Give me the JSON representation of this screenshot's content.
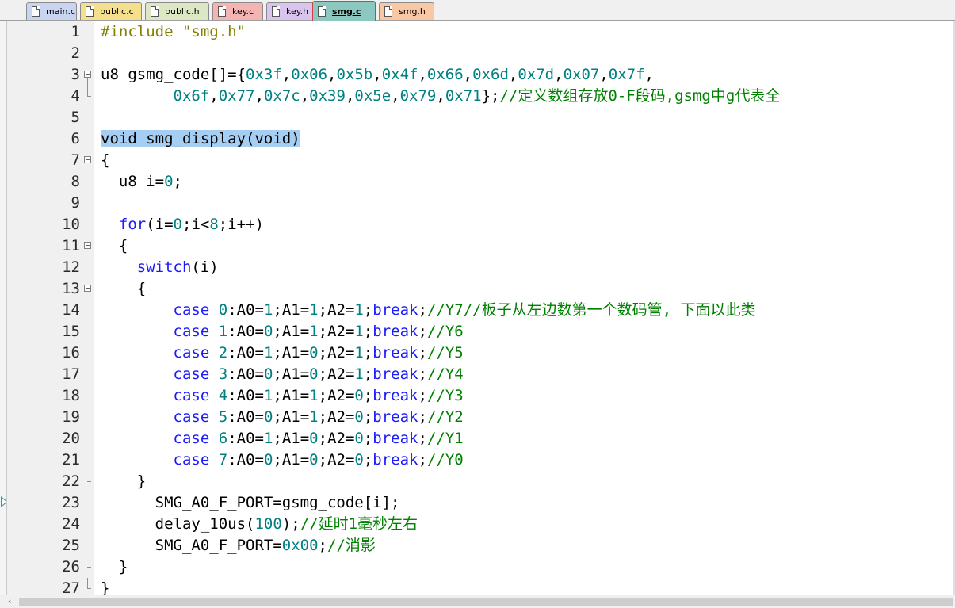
{
  "tabs": [
    {
      "label": "main.c",
      "color": "#c8d4f0",
      "active": false
    },
    {
      "label": "public.c",
      "color": "#f4e08c",
      "active": false
    },
    {
      "label": "public.h",
      "color": "#dce8c4",
      "active": false
    },
    {
      "label": "key.c",
      "color": "#f4b4b4",
      "active": false
    },
    {
      "label": "key.h",
      "color": "#d8c4ec",
      "active": false
    },
    {
      "label": "smg.c",
      "color": "#8cc8c0",
      "active": true
    },
    {
      "label": "smg.h",
      "color": "#f8c8a4",
      "active": false
    }
  ],
  "editor": {
    "current_line": 23,
    "selection": "void smg_display(void)",
    "lines": [
      {
        "n": "1",
        "text": "#include \"smg.h\""
      },
      {
        "n": "2",
        "text": ""
      },
      {
        "n": "3",
        "text": "u8 gsmg_code[]={0x3f,0x06,0x5b,0x4f,0x66,0x6d,0x7d,0x07,0x7f,"
      },
      {
        "n": "4",
        "text": "        0x6f,0x77,0x7c,0x39,0x5e,0x79,0x71};//定义数组存放0-F段码,gsmg中g代表全"
      },
      {
        "n": "5",
        "text": ""
      },
      {
        "n": "6",
        "text": "void smg_display(void)"
      },
      {
        "n": "7",
        "text": "{"
      },
      {
        "n": "8",
        "text": "  u8 i=0;"
      },
      {
        "n": "9",
        "text": ""
      },
      {
        "n": "10",
        "text": "  for(i=0;i<8;i++)"
      },
      {
        "n": "11",
        "text": "  {"
      },
      {
        "n": "12",
        "text": "    switch(i)"
      },
      {
        "n": "13",
        "text": "    {"
      },
      {
        "n": "14",
        "text": "        case 0:A0=1;A1=1;A2=1;break;//Y7//板子从左边数第一个数码管, 下面以此类"
      },
      {
        "n": "15",
        "text": "        case 1:A0=0;A1=1;A2=1;break;//Y6"
      },
      {
        "n": "16",
        "text": "        case 2:A0=1;A1=0;A2=1;break;//Y5"
      },
      {
        "n": "17",
        "text": "        case 3:A0=0;A1=0;A2=1;break;//Y4"
      },
      {
        "n": "18",
        "text": "        case 4:A0=1;A1=1;A2=0;break;//Y3"
      },
      {
        "n": "19",
        "text": "        case 5:A0=0;A1=1;A2=0;break;//Y2"
      },
      {
        "n": "20",
        "text": "        case 6:A0=1;A1=0;A2=0;break;//Y1"
      },
      {
        "n": "21",
        "text": "        case 7:A0=0;A1=0;A2=0;break;//Y0"
      },
      {
        "n": "22",
        "text": "    }"
      },
      {
        "n": "23",
        "text": "      SMG_A0_F_PORT=gsmg_code[i];"
      },
      {
        "n": "24",
        "text": "      delay_10us(100);//延时1毫秒左右"
      },
      {
        "n": "25",
        "text": "      SMG_A0_F_PORT=0x00;//消影"
      },
      {
        "n": "26",
        "text": "  }"
      },
      {
        "n": "27",
        "text": "}"
      }
    ]
  },
  "scrollbar": {
    "left_arrow": "‹"
  }
}
